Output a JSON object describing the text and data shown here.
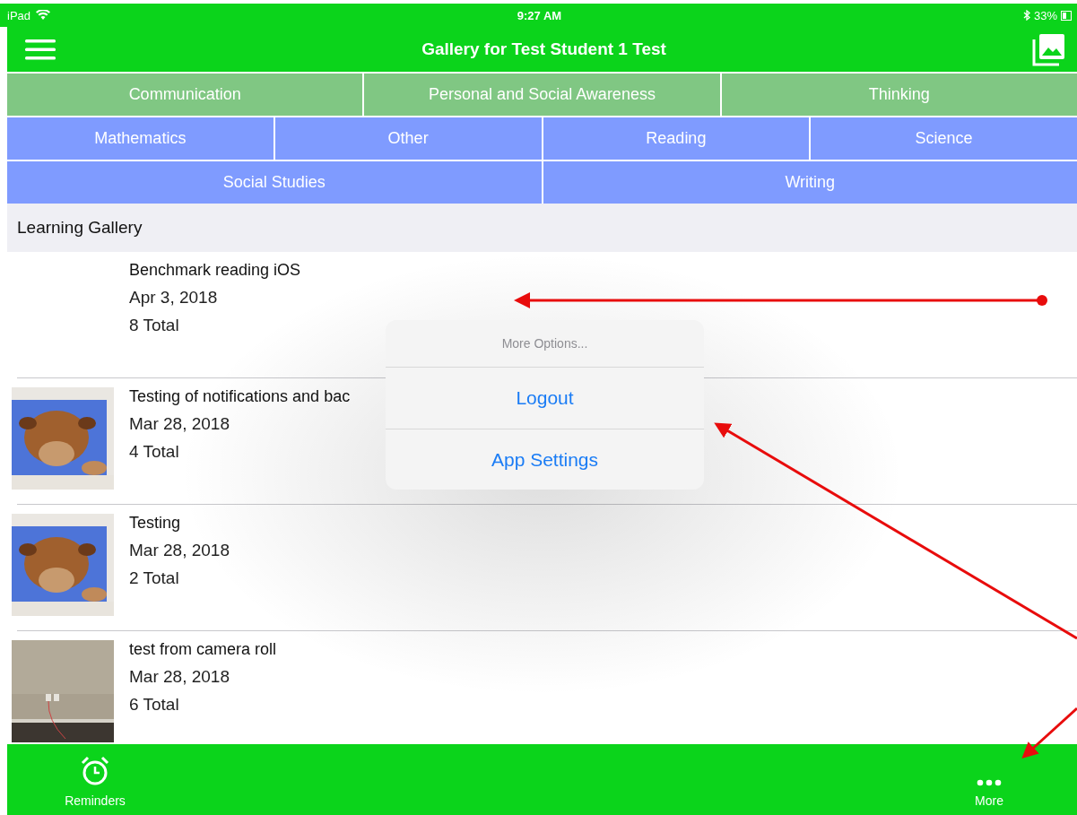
{
  "status_bar": {
    "device": "iPad",
    "time": "9:27 AM",
    "battery": "33%"
  },
  "nav": {
    "title": "Gallery for Test Student 1 Test"
  },
  "category_rows": [
    [
      {
        "label": "Communication",
        "color": "#80c783"
      },
      {
        "label": "Personal and Social Awareness",
        "color": "#80c783"
      },
      {
        "label": "Thinking",
        "color": "#80c783"
      }
    ],
    [
      {
        "label": "Mathematics",
        "color": "#7f9bff"
      },
      {
        "label": "Other",
        "color": "#7f9bff"
      },
      {
        "label": "Reading",
        "color": "#7f9bff"
      },
      {
        "label": "Science",
        "color": "#7f9bff"
      }
    ],
    [
      {
        "label": "Social Studies",
        "color": "#7f9bff"
      },
      {
        "label": "Writing",
        "color": "#7f9bff"
      }
    ]
  ],
  "section": {
    "title": "Learning Gallery"
  },
  "items": [
    {
      "title": "Benchmark reading iOS",
      "date": "Apr 3, 2018",
      "total": "8 Total",
      "picture": false
    },
    {
      "title": "Testing of notifications and bac",
      "date": "Mar 28, 2018",
      "total": "4 Total",
      "picture": true
    },
    {
      "title": "Testing",
      "date": "Mar 28, 2018",
      "total": "2 Total",
      "picture": true
    },
    {
      "title": "test from camera roll",
      "date": "Mar 28, 2018",
      "total": "6 Total",
      "picture": true
    }
  ],
  "popover": {
    "title": "More Options...",
    "actions": [
      "Logout",
      "App Settings"
    ]
  },
  "tab_bar": [
    {
      "label": "Reminders",
      "kind": "alarm"
    },
    {
      "label": "More",
      "kind": "more"
    }
  ]
}
